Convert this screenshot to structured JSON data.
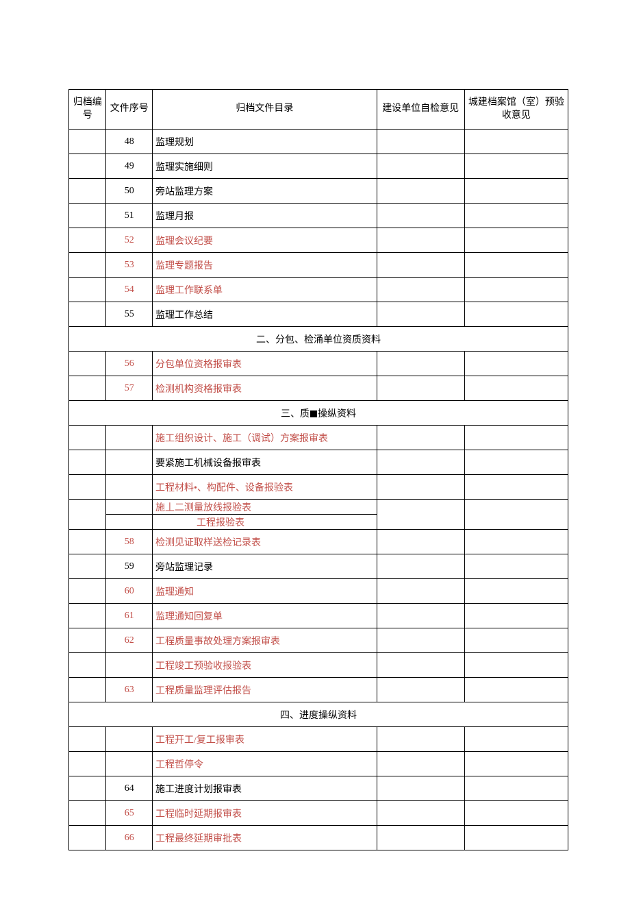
{
  "headers": {
    "archive_no": "归档编号",
    "file_seq": "文件序号",
    "file_catalog": "归档文件目录",
    "self_check": "建设单位自检意见",
    "city_check": "城建档案馆（室）预验收意见"
  },
  "rows": [
    {
      "seq": "48",
      "name": "监理规划",
      "red": false
    },
    {
      "seq": "49",
      "name": "监理实施细则",
      "red": false
    },
    {
      "seq": "50",
      "name": "旁站监理方案",
      "red": false
    },
    {
      "seq": "51",
      "name": "监理月报",
      "red": false
    },
    {
      "seq": "52",
      "name": "监理会议纪要",
      "red": true
    },
    {
      "seq": "53",
      "name": "监理专题报告",
      "red": true
    },
    {
      "seq": "54",
      "name": "监理工作联系单",
      "red": true
    },
    {
      "seq": "55",
      "name": "监理工作总结",
      "red": false
    },
    {
      "section": "二、分包、检涌单位资质资料"
    },
    {
      "seq": "56",
      "name": "分包单位资格报审表",
      "red": true
    },
    {
      "seq": "57",
      "name": "检测机构资格报审表",
      "red": true
    },
    {
      "section": "三、质■操纵资料",
      "has_block": true,
      "pre": "三、质",
      "post": "操纵资料"
    },
    {
      "seq": "",
      "name": "施工组织设计、施工（调试）方案报审表",
      "red": true
    },
    {
      "seq": "",
      "name": "要紧施工机械设备报审表",
      "red": false
    },
    {
      "seq": "",
      "name": "工程材料•、构配件、设备报验表",
      "red": true
    },
    {
      "stacked": true,
      "top": {
        "seq": "",
        "name": "施丄二测量放线报验表",
        "red": true
      },
      "bot": {
        "seq": "",
        "name": "工程报验表",
        "red": true,
        "indent": true
      }
    },
    {
      "seq": "58",
      "name": "检测见证取样送检记录表",
      "red": true
    },
    {
      "seq": "59",
      "name": "旁站监理记录",
      "red": false
    },
    {
      "seq": "60",
      "name": "监理通知",
      "red": true
    },
    {
      "seq": "61",
      "name": "监理通知回复单",
      "red": true
    },
    {
      "seq": "62",
      "name": "工程质量事故处理方案报审表",
      "red": true
    },
    {
      "seq": "",
      "name": "工程竣工预验收报验表",
      "red": true
    },
    {
      "seq": "63",
      "name": "工程质量监理评估报告",
      "red": true
    },
    {
      "section": "四、进度操纵资料"
    },
    {
      "seq": "",
      "name": "工程开工/复工报审表",
      "red": true
    },
    {
      "seq": "",
      "name": "工程哲停令",
      "red": true
    },
    {
      "seq": "64",
      "name": "施工进度计划报审表",
      "red": false
    },
    {
      "seq": "65",
      "name": "工程临时延期报审表",
      "red": true
    },
    {
      "seq": "66",
      "name": "工程最终延期审批表",
      "red": true
    }
  ]
}
